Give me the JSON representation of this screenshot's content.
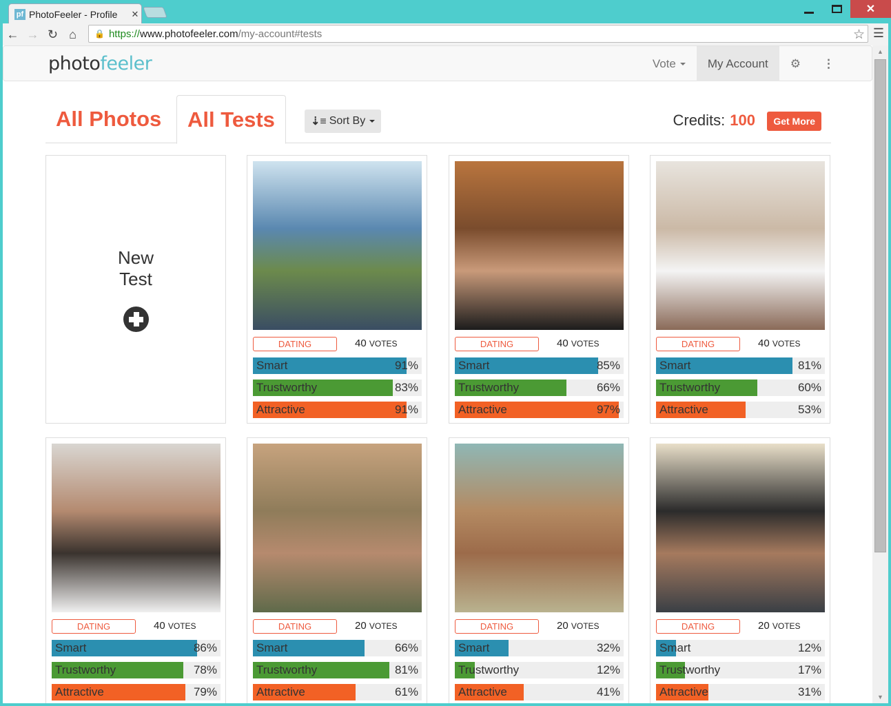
{
  "browser": {
    "tab_title": "PhotoFeeler - Profile",
    "favicon_text": "pf",
    "url_scheme": "https://",
    "url_domain": "www.photofeeler.com",
    "url_path": "/my-account#tests"
  },
  "navbar": {
    "logo_part1": "photo",
    "logo_part2": "feeler",
    "vote_label": "Vote",
    "my_account_label": "My Account"
  },
  "page": {
    "tabs": [
      {
        "label": "All Photos",
        "active": false
      },
      {
        "label": "All Tests",
        "active": true
      }
    ],
    "sort_label": "Sort By",
    "credits_label": "Credits:",
    "credits_value": "100",
    "get_more_label": "Get More",
    "new_test_line1": "New",
    "new_test_line2": "Test"
  },
  "colors": {
    "accent": "#ee5a3e",
    "smart": "#2b8fb0",
    "trustworthy": "#4b9a34",
    "attractive": "#f26125",
    "bar_bg": "#eeeeee"
  },
  "tests": [
    {
      "category": "DATING",
      "votes": "40",
      "votes_label": "VOTES",
      "photo_colors": [
        "#cfe3ef",
        "#5a88b0",
        "#6c8a4c",
        "#3a4d63"
      ],
      "scores": [
        {
          "label": "Smart",
          "value": 91
        },
        {
          "label": "Trustworthy",
          "value": 83
        },
        {
          "label": "Attractive",
          "value": 91
        }
      ]
    },
    {
      "category": "DATING",
      "votes": "40",
      "votes_label": "VOTES",
      "photo_colors": [
        "#b9753e",
        "#7a4c2d",
        "#c99a7a",
        "#1c1c1c"
      ],
      "scores": [
        {
          "label": "Smart",
          "value": 85
        },
        {
          "label": "Trustworthy",
          "value": 66
        },
        {
          "label": "Attractive",
          "value": 97
        }
      ]
    },
    {
      "category": "DATING",
      "votes": "40",
      "votes_label": "VOTES",
      "photo_colors": [
        "#e8e4de",
        "#cbb9a6",
        "#f4f4f4",
        "#8a6a58"
      ],
      "scores": [
        {
          "label": "Smart",
          "value": 81
        },
        {
          "label": "Trustworthy",
          "value": 60
        },
        {
          "label": "Attractive",
          "value": 53
        }
      ]
    },
    {
      "category": "DATING",
      "votes": "40",
      "votes_label": "VOTES",
      "photo_colors": [
        "#d9d6d2",
        "#b48a70",
        "#3a332e",
        "#f0f0f0"
      ],
      "scores": [
        {
          "label": "Smart",
          "value": 86
        },
        {
          "label": "Trustworthy",
          "value": 78
        },
        {
          "label": "Attractive",
          "value": 79
        }
      ]
    },
    {
      "category": "DATING",
      "votes": "20",
      "votes_label": "VOTES",
      "photo_colors": [
        "#c7a37e",
        "#8f7c5a",
        "#b68a6e",
        "#5f6a4a"
      ],
      "scores": [
        {
          "label": "Smart",
          "value": 66
        },
        {
          "label": "Trustworthy",
          "value": 81
        },
        {
          "label": "Attractive",
          "value": 61
        }
      ]
    },
    {
      "category": "DATING",
      "votes": "20",
      "votes_label": "VOTES",
      "photo_colors": [
        "#8fb7b5",
        "#b48a62",
        "#9c6b4a",
        "#b9b28f"
      ],
      "scores": [
        {
          "label": "Smart",
          "value": 32
        },
        {
          "label": "Trustworthy",
          "value": 12
        },
        {
          "label": "Attractive",
          "value": 41
        }
      ]
    },
    {
      "category": "DATING",
      "votes": "20",
      "votes_label": "VOTES",
      "photo_colors": [
        "#e9dfc9",
        "#2b2b2b",
        "#a67a5e",
        "#3a3f45"
      ],
      "scores": [
        {
          "label": "Smart",
          "value": 12
        },
        {
          "label": "Trustworthy",
          "value": 17
        },
        {
          "label": "Attractive",
          "value": 31
        }
      ]
    }
  ]
}
